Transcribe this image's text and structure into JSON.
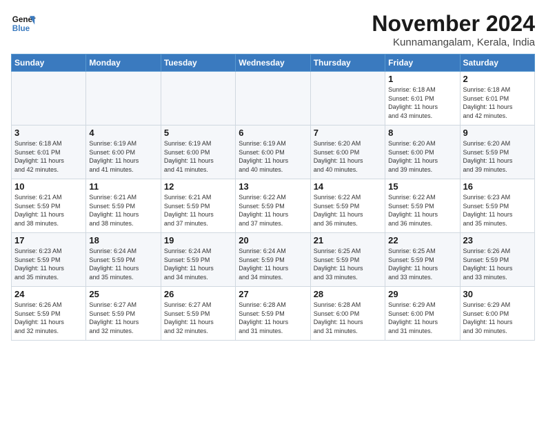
{
  "header": {
    "logo_line1": "General",
    "logo_line2": "Blue",
    "title": "November 2024",
    "location": "Kunnamangalam, Kerala, India"
  },
  "weekdays": [
    "Sunday",
    "Monday",
    "Tuesday",
    "Wednesday",
    "Thursday",
    "Friday",
    "Saturday"
  ],
  "weeks": [
    [
      {
        "day": "",
        "info": ""
      },
      {
        "day": "",
        "info": ""
      },
      {
        "day": "",
        "info": ""
      },
      {
        "day": "",
        "info": ""
      },
      {
        "day": "",
        "info": ""
      },
      {
        "day": "1",
        "info": "Sunrise: 6:18 AM\nSunset: 6:01 PM\nDaylight: 11 hours\nand 43 minutes."
      },
      {
        "day": "2",
        "info": "Sunrise: 6:18 AM\nSunset: 6:01 PM\nDaylight: 11 hours\nand 42 minutes."
      }
    ],
    [
      {
        "day": "3",
        "info": "Sunrise: 6:18 AM\nSunset: 6:01 PM\nDaylight: 11 hours\nand 42 minutes."
      },
      {
        "day": "4",
        "info": "Sunrise: 6:19 AM\nSunset: 6:00 PM\nDaylight: 11 hours\nand 41 minutes."
      },
      {
        "day": "5",
        "info": "Sunrise: 6:19 AM\nSunset: 6:00 PM\nDaylight: 11 hours\nand 41 minutes."
      },
      {
        "day": "6",
        "info": "Sunrise: 6:19 AM\nSunset: 6:00 PM\nDaylight: 11 hours\nand 40 minutes."
      },
      {
        "day": "7",
        "info": "Sunrise: 6:20 AM\nSunset: 6:00 PM\nDaylight: 11 hours\nand 40 minutes."
      },
      {
        "day": "8",
        "info": "Sunrise: 6:20 AM\nSunset: 6:00 PM\nDaylight: 11 hours\nand 39 minutes."
      },
      {
        "day": "9",
        "info": "Sunrise: 6:20 AM\nSunset: 5:59 PM\nDaylight: 11 hours\nand 39 minutes."
      }
    ],
    [
      {
        "day": "10",
        "info": "Sunrise: 6:21 AM\nSunset: 5:59 PM\nDaylight: 11 hours\nand 38 minutes."
      },
      {
        "day": "11",
        "info": "Sunrise: 6:21 AM\nSunset: 5:59 PM\nDaylight: 11 hours\nand 38 minutes."
      },
      {
        "day": "12",
        "info": "Sunrise: 6:21 AM\nSunset: 5:59 PM\nDaylight: 11 hours\nand 37 minutes."
      },
      {
        "day": "13",
        "info": "Sunrise: 6:22 AM\nSunset: 5:59 PM\nDaylight: 11 hours\nand 37 minutes."
      },
      {
        "day": "14",
        "info": "Sunrise: 6:22 AM\nSunset: 5:59 PM\nDaylight: 11 hours\nand 36 minutes."
      },
      {
        "day": "15",
        "info": "Sunrise: 6:22 AM\nSunset: 5:59 PM\nDaylight: 11 hours\nand 36 minutes."
      },
      {
        "day": "16",
        "info": "Sunrise: 6:23 AM\nSunset: 5:59 PM\nDaylight: 11 hours\nand 35 minutes."
      }
    ],
    [
      {
        "day": "17",
        "info": "Sunrise: 6:23 AM\nSunset: 5:59 PM\nDaylight: 11 hours\nand 35 minutes."
      },
      {
        "day": "18",
        "info": "Sunrise: 6:24 AM\nSunset: 5:59 PM\nDaylight: 11 hours\nand 35 minutes."
      },
      {
        "day": "19",
        "info": "Sunrise: 6:24 AM\nSunset: 5:59 PM\nDaylight: 11 hours\nand 34 minutes."
      },
      {
        "day": "20",
        "info": "Sunrise: 6:24 AM\nSunset: 5:59 PM\nDaylight: 11 hours\nand 34 minutes."
      },
      {
        "day": "21",
        "info": "Sunrise: 6:25 AM\nSunset: 5:59 PM\nDaylight: 11 hours\nand 33 minutes."
      },
      {
        "day": "22",
        "info": "Sunrise: 6:25 AM\nSunset: 5:59 PM\nDaylight: 11 hours\nand 33 minutes."
      },
      {
        "day": "23",
        "info": "Sunrise: 6:26 AM\nSunset: 5:59 PM\nDaylight: 11 hours\nand 33 minutes."
      }
    ],
    [
      {
        "day": "24",
        "info": "Sunrise: 6:26 AM\nSunset: 5:59 PM\nDaylight: 11 hours\nand 32 minutes."
      },
      {
        "day": "25",
        "info": "Sunrise: 6:27 AM\nSunset: 5:59 PM\nDaylight: 11 hours\nand 32 minutes."
      },
      {
        "day": "26",
        "info": "Sunrise: 6:27 AM\nSunset: 5:59 PM\nDaylight: 11 hours\nand 32 minutes."
      },
      {
        "day": "27",
        "info": "Sunrise: 6:28 AM\nSunset: 5:59 PM\nDaylight: 11 hours\nand 31 minutes."
      },
      {
        "day": "28",
        "info": "Sunrise: 6:28 AM\nSunset: 6:00 PM\nDaylight: 11 hours\nand 31 minutes."
      },
      {
        "day": "29",
        "info": "Sunrise: 6:29 AM\nSunset: 6:00 PM\nDaylight: 11 hours\nand 31 minutes."
      },
      {
        "day": "30",
        "info": "Sunrise: 6:29 AM\nSunset: 6:00 PM\nDaylight: 11 hours\nand 30 minutes."
      }
    ]
  ]
}
